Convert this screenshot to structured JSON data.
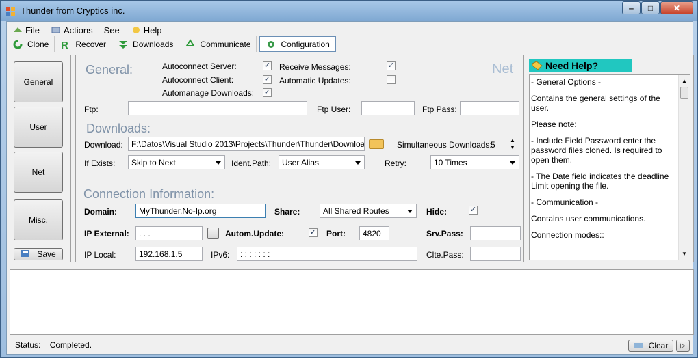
{
  "window": {
    "title": "Thunder from Cryptics inc."
  },
  "menu": [
    "File",
    "Actions",
    "See",
    "Help"
  ],
  "toolbar": [
    "Clone",
    "Recover",
    "Downloads",
    "Communicate",
    "Configuration"
  ],
  "sidebar": {
    "general": "General",
    "user": "User",
    "net": "Net",
    "misc": "Misc.",
    "save": "Save"
  },
  "general": {
    "heading": "General:",
    "autoconnect_server": "Autoconnect Server:",
    "autoconnect_client": "Autoconnect Client:",
    "automanage_downloads": "Automanage Downloads:",
    "receive_messages": "Receive Messages:",
    "automatic_updates": "Automatic Updates:",
    "net_label": "Net",
    "ftp_label": "Ftp:",
    "ftp_user_label": "Ftp User:",
    "ftp_pass_label": "Ftp Pass:"
  },
  "downloads": {
    "heading": "Downloads:",
    "download_label": "Download:",
    "download_path": "F:\\Datos\\Visual Studio 2013\\Projects\\Thunder\\Thunder\\Downloa",
    "simultaneous_label": "Simultaneous Downloads:",
    "simultaneous_value": "5",
    "if_exists_label": "If Exists:",
    "if_exists_value": "Skip to Next",
    "ident_path_label": "Ident.Path:",
    "ident_path_value": "User Alias",
    "retry_label": "Retry:",
    "retry_value": "10 Times"
  },
  "connection": {
    "heading": "Connection Information:",
    "domain_label": "Domain:",
    "domain_value": "MyThunder.No-Ip.org",
    "share_label": "Share:",
    "share_value": "All Shared Routes",
    "hide_label": "Hide:",
    "ip_external_label": "IP External:",
    "ip_external_value": ".   .   .",
    "autom_update_label": "Autom.Update:",
    "port_label": "Port:",
    "port_value": "4820",
    "srv_pass_label": "Srv.Pass:",
    "ip_local_label": "IP Local:",
    "ip_local_value": "192.168.1.5",
    "ipv6_label": "IPv6:",
    "ipv6_value": ":   :   :   :   :   :   :",
    "clte_pass_label": "Clte.Pass:"
  },
  "help": {
    "title": "Need Help?",
    "lines": [
      "- General Options -",
      "Contains the general settings of the user.",
      "Please note:",
      "- Include Field Password enter the password files cloned. Is required to open them.",
      "- The Date field indicates the deadline Limit opening the file.",
      "- Communication -",
      "Contains user communications.",
      "Connection modes::"
    ]
  },
  "status": {
    "label": "Status:",
    "value": "Completed.",
    "clear": "Clear"
  }
}
